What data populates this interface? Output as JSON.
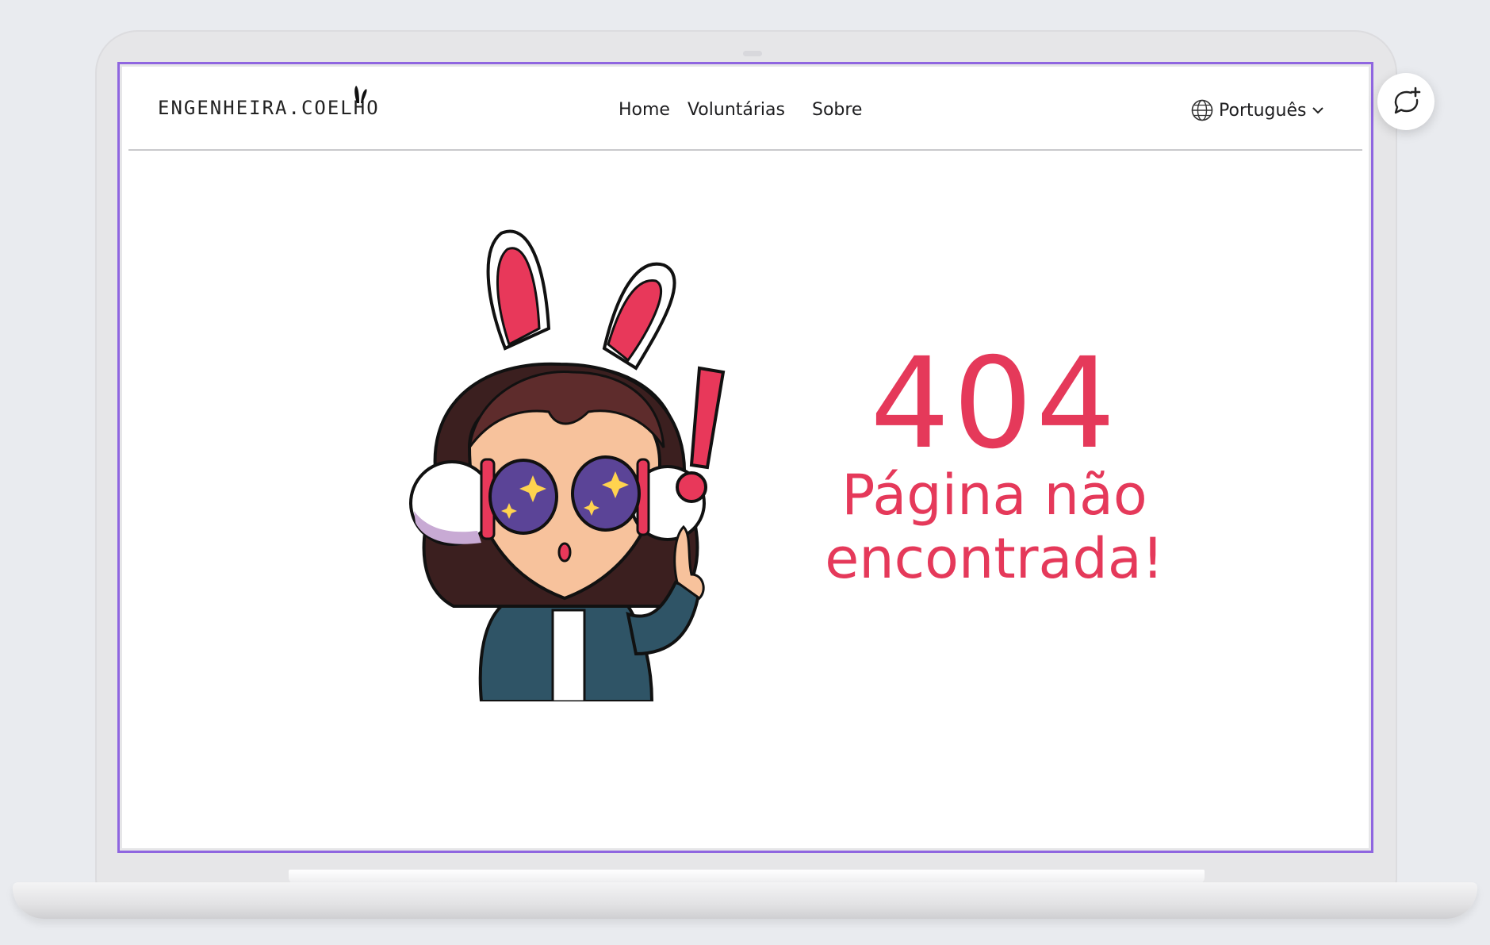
{
  "nav": {
    "logo_text": "ENGENHEIRA.COELHO",
    "links": [
      "Home",
      "Voluntárias",
      "Sobre"
    ],
    "language": "Português"
  },
  "error": {
    "code": "404",
    "line1": "Página não",
    "line2": "encontrada!"
  },
  "icons": [
    "globe-icon",
    "chevron-down-icon",
    "feedback-chat-icon",
    "bunny-ears-logo-icon"
  ],
  "colors": {
    "accent": "#e5395a",
    "frame_outline": "#8f66e0",
    "background": "#e9ebef"
  }
}
